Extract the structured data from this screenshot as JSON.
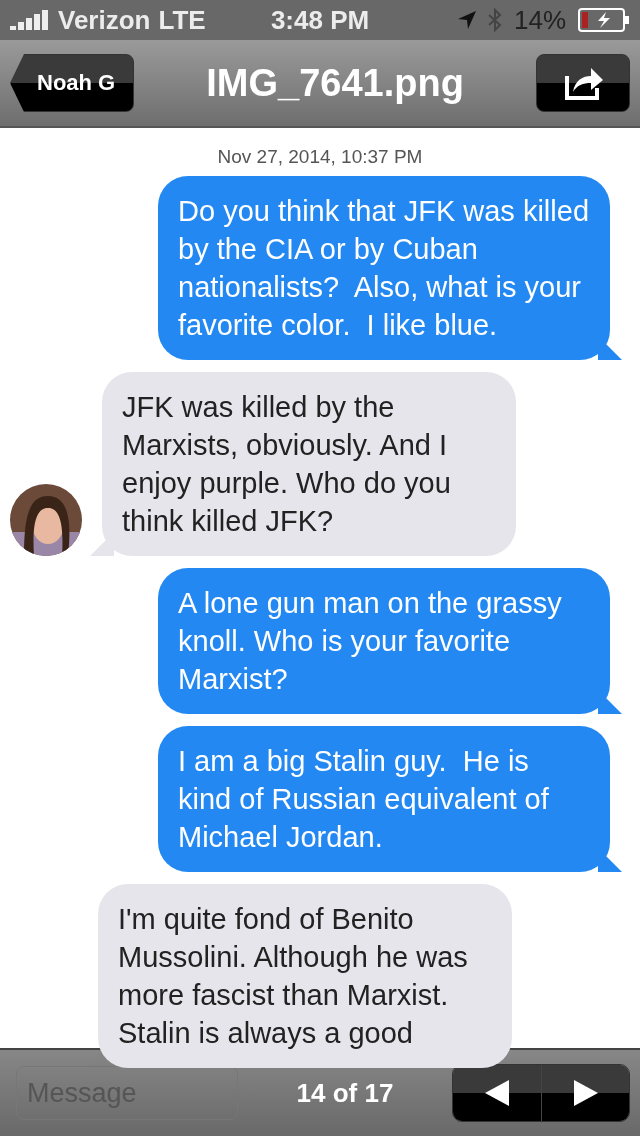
{
  "status_bar": {
    "carrier": "Verizon",
    "network": "LTE",
    "time": "3:48 PM",
    "battery": "14%"
  },
  "nav_bar": {
    "back": "Noah G",
    "title": "IMG_7641.png"
  },
  "timestamp": "Nov 27, 2014, 10:37 PM",
  "messages": [
    {
      "kind": "sent",
      "text": "Do you think that JFK was killed by the CIA or by Cuban nationalists?  Also, what is your favorite color.  I like blue."
    },
    {
      "kind": "received",
      "avatar": true,
      "text": "JFK was killed by the Marxists, obviously. And I enjoy purple. Who do you think killed JFK?"
    },
    {
      "kind": "sent",
      "text": "A lone gun man on the grassy knoll. Who is your favorite Marxist?"
    },
    {
      "kind": "sent",
      "text": "I am a big Stalin guy.  He is kind of Russian equivalent of Michael Jordan."
    },
    {
      "kind": "received",
      "avatar": false,
      "text": "I'm quite fond of Benito Mussolini. Although he was more fascist than Marxist. Stalin is always a good"
    }
  ],
  "bottom_bar": {
    "placeholder": "Message",
    "counter": "14 of 17"
  }
}
